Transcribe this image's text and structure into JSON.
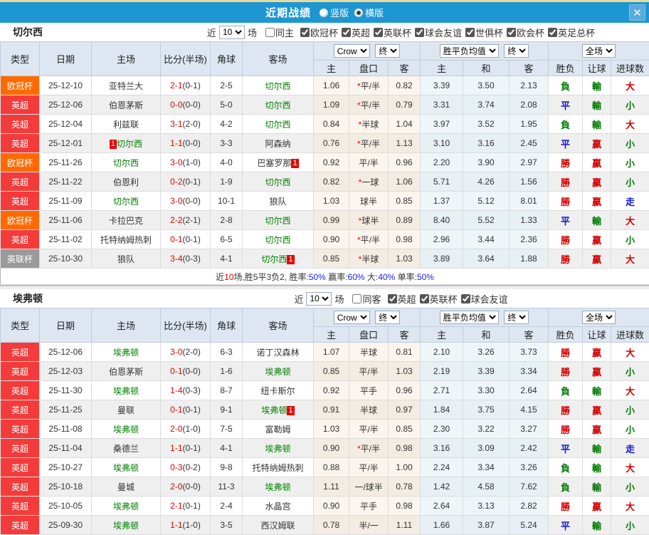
{
  "palette": {
    "type": {
      "orange": "#ff6a00",
      "red": "#f43b3b",
      "gray": "#9a9a9a"
    },
    "result": {
      "r": "#d40000",
      "g": "#007a00",
      "b": "#1414cc"
    }
  },
  "topbar": {
    "title": "近期战绩",
    "radio_vertical": "竖版",
    "radio_horizontal": "横版",
    "close_glyph": "✕"
  },
  "labels": {
    "jin": "近",
    "chang": "场",
    "type": "类型",
    "date": "日期",
    "home": "主场",
    "score": "比分(半场)",
    "corner": "角球",
    "away": "客场",
    "crow": "Crow",
    "final": "终",
    "avg": "胜平负均值",
    "full": "全场",
    "sub_home": "主",
    "sub_handicap": "盘口",
    "sub_away": "客",
    "sub_h": "主",
    "sub_d": "和",
    "sub_a": "客",
    "wdl": "胜负",
    "let_goal": "让球",
    "goals": "进球数"
  },
  "sections": [
    {
      "team": "切尔西",
      "recent_count": "10",
      "same_label": "同主",
      "leagues": [
        "欧冠杯",
        "英超",
        "英联杯",
        "球会友谊",
        "世俱杯",
        "欧会杯",
        "英足总杯"
      ],
      "rows": [
        {
          "t": "欧冠杯",
          "tc": "orange",
          "d": "25-12-10",
          "h": "亚特兰大",
          "hg": false,
          "hb": "",
          "s": "2-1",
          "sh": "(0-1)",
          "c": "2-5",
          "a": "切尔西",
          "ag": true,
          "ab": "",
          "o1": "1.06",
          "st": true,
          "hc": "平/半",
          "o2": "0.82",
          "m1": "3.39",
          "m2": "3.50",
          "m3": "2.13",
          "r1": "負",
          "c1": "g",
          "r2": "輸",
          "c2": "g",
          "r3": "大",
          "c3": "r"
        },
        {
          "t": "英超",
          "tc": "red",
          "d": "25-12-06",
          "h": "伯恩茅斯",
          "hg": false,
          "hb": "",
          "s": "0-0",
          "sh": "(0-0)",
          "c": "5-0",
          "a": "切尔西",
          "ag": true,
          "ab": "",
          "o1": "1.09",
          "st": true,
          "hc": "平/半",
          "o2": "0.79",
          "m1": "3.31",
          "m2": "3.74",
          "m3": "2.08",
          "r1": "平",
          "c1": "b",
          "r2": "輸",
          "c2": "g",
          "r3": "小",
          "c3": "g"
        },
        {
          "t": "英超",
          "tc": "red",
          "d": "25-12-04",
          "h": "利兹联",
          "hg": false,
          "hb": "",
          "s": "3-1",
          "sh": "(2-0)",
          "c": "4-2",
          "a": "切尔西",
          "ag": true,
          "ab": "",
          "o1": "0.84",
          "st": true,
          "hc": "半球",
          "o2": "1.04",
          "m1": "3.97",
          "m2": "3.52",
          "m3": "1.95",
          "r1": "負",
          "c1": "g",
          "r2": "輸",
          "c2": "g",
          "r3": "大",
          "c3": "r"
        },
        {
          "t": "英超",
          "tc": "red",
          "d": "25-12-01",
          "h": "切尔西",
          "hg": true,
          "hb": "1",
          "s": "1-1",
          "sh": "(0-0)",
          "c": "3-3",
          "a": "阿森纳",
          "ag": false,
          "ab": "",
          "o1": "0.76",
          "st": true,
          "hc": "平/半",
          "o2": "1.13",
          "m1": "3.10",
          "m2": "3.16",
          "m3": "2.45",
          "r1": "平",
          "c1": "b",
          "r2": "贏",
          "c2": "r",
          "r3": "小",
          "c3": "g"
        },
        {
          "t": "欧冠杯",
          "tc": "orange",
          "d": "25-11-26",
          "h": "切尔西",
          "hg": true,
          "hb": "",
          "s": "3-0",
          "sh": "(1-0)",
          "c": "4-0",
          "a": "巴塞罗那",
          "ag": false,
          "ab": "1",
          "o1": "0.92",
          "st": false,
          "hc": "平/半",
          "o2": "0.96",
          "m1": "2.20",
          "m2": "3.90",
          "m3": "2.97",
          "r1": "勝",
          "c1": "r",
          "r2": "贏",
          "c2": "r",
          "r3": "小",
          "c3": "g"
        },
        {
          "t": "英超",
          "tc": "red",
          "d": "25-11-22",
          "h": "伯恩利",
          "hg": false,
          "hb": "",
          "s": "0-2",
          "sh": "(0-1)",
          "c": "1-9",
          "a": "切尔西",
          "ag": true,
          "ab": "",
          "o1": "0.82",
          "st": true,
          "hc": "一球",
          "o2": "1.06",
          "m1": "5.71",
          "m2": "4.26",
          "m3": "1.56",
          "r1": "勝",
          "c1": "r",
          "r2": "贏",
          "c2": "r",
          "r3": "小",
          "c3": "g"
        },
        {
          "t": "英超",
          "tc": "red",
          "d": "25-11-09",
          "h": "切尔西",
          "hg": true,
          "hb": "",
          "s": "3-0",
          "sh": "(0-0)",
          "c": "10-1",
          "a": "狼队",
          "ag": false,
          "ab": "",
          "o1": "1.03",
          "st": false,
          "hc": "球半",
          "o2": "0.85",
          "m1": "1.37",
          "m2": "5.12",
          "m3": "8.01",
          "r1": "勝",
          "c1": "r",
          "r2": "贏",
          "c2": "r",
          "r3": "走",
          "c3": "b"
        },
        {
          "t": "欧冠杯",
          "tc": "orange",
          "d": "25-11-06",
          "h": "卡拉巴克",
          "hg": false,
          "hb": "",
          "s": "2-2",
          "sh": "(2-1)",
          "c": "2-8",
          "a": "切尔西",
          "ag": true,
          "ab": "",
          "o1": "0.99",
          "st": true,
          "hc": "球半",
          "o2": "0.89",
          "m1": "8.40",
          "m2": "5.52",
          "m3": "1.33",
          "r1": "平",
          "c1": "b",
          "r2": "輸",
          "c2": "g",
          "r3": "大",
          "c3": "r"
        },
        {
          "t": "英超",
          "tc": "red",
          "d": "25-11-02",
          "h": "托特纳姆热刺",
          "hg": false,
          "hb": "",
          "s": "0-1",
          "sh": "(0-1)",
          "c": "6-5",
          "a": "切尔西",
          "ag": true,
          "ab": "",
          "o1": "0.90",
          "st": true,
          "hc": "平/半",
          "o2": "0.98",
          "m1": "2.96",
          "m2": "3.44",
          "m3": "2.36",
          "r1": "勝",
          "c1": "r",
          "r2": "贏",
          "c2": "r",
          "r3": "小",
          "c3": "g"
        },
        {
          "t": "英联杯",
          "tc": "gray",
          "d": "25-10-30",
          "h": "狼队",
          "hg": false,
          "hb": "",
          "s": "3-4",
          "sh": "(0-3)",
          "c": "4-1",
          "a": "切尔西",
          "ag": true,
          "ab": "1",
          "o1": "0.85",
          "st": true,
          "hc": "半球",
          "o2": "1.03",
          "m1": "3.89",
          "m2": "3.64",
          "m3": "1.88",
          "r1": "勝",
          "c1": "r",
          "r2": "贏",
          "c2": "r",
          "r3": "大",
          "c3": "r"
        }
      ],
      "summary_parts": [
        {
          "text": "近",
          "color": "dark"
        },
        {
          "text": "10",
          "color": "red"
        },
        {
          "text": "场,胜5平3负2, ",
          "color": "dark"
        },
        {
          "text": "胜率",
          "color": "dark"
        },
        {
          "text": ":50%",
          "color": "blue"
        },
        {
          "text": " 赢率",
          "color": "dark"
        },
        {
          "text": ":60%",
          "color": "blue"
        },
        {
          "text": " 大",
          "color": "dark"
        },
        {
          "text": ":40%",
          "color": "blue"
        },
        {
          "text": " 单率",
          "color": "dark"
        },
        {
          "text": ":50%",
          "color": "blue"
        }
      ]
    },
    {
      "team": "埃弗顿",
      "recent_count": "10",
      "same_label": "同客",
      "leagues": [
        "英超",
        "英联杯",
        "球会友谊"
      ],
      "rows": [
        {
          "t": "英超",
          "tc": "red",
          "d": "25-12-06",
          "h": "埃弗顿",
          "hg": true,
          "hb": "",
          "s": "3-0",
          "sh": "(2-0)",
          "c": "6-3",
          "a": "诺丁汉森林",
          "ag": false,
          "ab": "",
          "o1": "1.07",
          "st": false,
          "hc": "半球",
          "o2": "0.81",
          "m1": "2.10",
          "m2": "3.26",
          "m3": "3.73",
          "r1": "勝",
          "c1": "r",
          "r2": "贏",
          "c2": "r",
          "r3": "大",
          "c3": "r"
        },
        {
          "t": "英超",
          "tc": "red",
          "d": "25-12-03",
          "h": "伯恩茅斯",
          "hg": false,
          "hb": "",
          "s": "0-1",
          "sh": "(0-0)",
          "c": "1-6",
          "a": "埃弗顿",
          "ag": true,
          "ab": "",
          "o1": "0.85",
          "st": false,
          "hc": "平/半",
          "o2": "1.03",
          "m1": "2.19",
          "m2": "3.39",
          "m3": "3.34",
          "r1": "勝",
          "c1": "r",
          "r2": "贏",
          "c2": "r",
          "r3": "小",
          "c3": "g"
        },
        {
          "t": "英超",
          "tc": "red",
          "d": "25-11-30",
          "h": "埃弗顿",
          "hg": true,
          "hb": "",
          "s": "1-4",
          "sh": "(0-3)",
          "c": "8-7",
          "a": "纽卡斯尔",
          "ag": false,
          "ab": "",
          "o1": "0.92",
          "st": false,
          "hc": "平手",
          "o2": "0.96",
          "m1": "2.71",
          "m2": "3.30",
          "m3": "2.64",
          "r1": "負",
          "c1": "g",
          "r2": "輸",
          "c2": "g",
          "r3": "大",
          "c3": "r"
        },
        {
          "t": "英超",
          "tc": "red",
          "d": "25-11-25",
          "h": "曼联",
          "hg": false,
          "hb": "",
          "s": "0-1",
          "sh": "(0-1)",
          "c": "9-1",
          "a": "埃弗顿",
          "ag": true,
          "ab": "1",
          "o1": "0.91",
          "st": false,
          "hc": "半球",
          "o2": "0.97",
          "m1": "1.84",
          "m2": "3.75",
          "m3": "4.15",
          "r1": "勝",
          "c1": "r",
          "r2": "贏",
          "c2": "r",
          "r3": "小",
          "c3": "g"
        },
        {
          "t": "英超",
          "tc": "red",
          "d": "25-11-08",
          "h": "埃弗顿",
          "hg": true,
          "hb": "",
          "s": "2-0",
          "sh": "(1-0)",
          "c": "7-5",
          "a": "富勒姆",
          "ag": false,
          "ab": "",
          "o1": "1.03",
          "st": false,
          "hc": "平/半",
          "o2": "0.85",
          "m1": "2.30",
          "m2": "3.22",
          "m3": "3.27",
          "r1": "勝",
          "c1": "r",
          "r2": "贏",
          "c2": "r",
          "r3": "小",
          "c3": "g"
        },
        {
          "t": "英超",
          "tc": "red",
          "d": "25-11-04",
          "h": "桑德兰",
          "hg": false,
          "hb": "",
          "s": "1-1",
          "sh": "(0-1)",
          "c": "4-1",
          "a": "埃弗顿",
          "ag": true,
          "ab": "",
          "o1": "0.90",
          "st": true,
          "hc": "平/半",
          "o2": "0.98",
          "m1": "3.16",
          "m2": "3.09",
          "m3": "2.42",
          "r1": "平",
          "c1": "b",
          "r2": "輸",
          "c2": "g",
          "r3": "走",
          "c3": "b"
        },
        {
          "t": "英超",
          "tc": "red",
          "d": "25-10-27",
          "h": "埃弗顿",
          "hg": true,
          "hb": "",
          "s": "0-3",
          "sh": "(0-2)",
          "c": "9-8",
          "a": "托特纳姆热刺",
          "ag": false,
          "ab": "",
          "o1": "0.88",
          "st": false,
          "hc": "平/半",
          "o2": "1.00",
          "m1": "2.24",
          "m2": "3.34",
          "m3": "3.26",
          "r1": "負",
          "c1": "g",
          "r2": "輸",
          "c2": "g",
          "r3": "大",
          "c3": "r"
        },
        {
          "t": "英超",
          "tc": "red",
          "d": "25-10-18",
          "h": "曼城",
          "hg": false,
          "hb": "",
          "s": "2-0",
          "sh": "(0-0)",
          "c": "11-3",
          "a": "埃弗顿",
          "ag": true,
          "ab": "",
          "o1": "1.11",
          "st": false,
          "hc": "一/球半",
          "o2": "0.78",
          "m1": "1.42",
          "m2": "4.58",
          "m3": "7.62",
          "r1": "負",
          "c1": "g",
          "r2": "輸",
          "c2": "g",
          "r3": "小",
          "c3": "g"
        },
        {
          "t": "英超",
          "tc": "red",
          "d": "25-10-05",
          "h": "埃弗顿",
          "hg": true,
          "hb": "",
          "s": "2-1",
          "sh": "(0-1)",
          "c": "2-4",
          "a": "水晶宫",
          "ag": false,
          "ab": "",
          "o1": "0.90",
          "st": false,
          "hc": "平手",
          "o2": "0.98",
          "m1": "2.64",
          "m2": "3.13",
          "m3": "2.82",
          "r1": "勝",
          "c1": "r",
          "r2": "贏",
          "c2": "r",
          "r3": "大",
          "c3": "r"
        },
        {
          "t": "英超",
          "tc": "red",
          "d": "25-09-30",
          "h": "埃弗顿",
          "hg": true,
          "hb": "",
          "s": "1-1",
          "sh": "(1-0)",
          "c": "3-5",
          "a": "西汉姆联",
          "ag": false,
          "ab": "",
          "o1": "0.78",
          "st": false,
          "hc": "半/一",
          "o2": "1.11",
          "m1": "1.66",
          "m2": "3.87",
          "m3": "5.24",
          "r1": "平",
          "c1": "b",
          "r2": "輸",
          "c2": "g",
          "r3": "小",
          "c3": "g"
        }
      ]
    }
  ]
}
